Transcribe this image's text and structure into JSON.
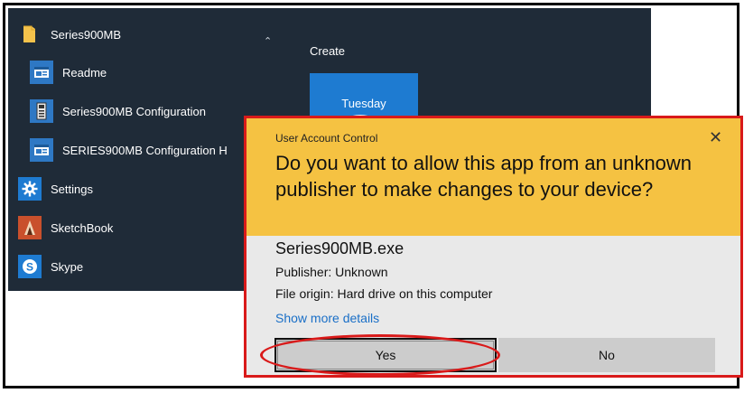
{
  "start_menu": {
    "group": {
      "label": "Series900MB",
      "icon": "folder-icon"
    },
    "items": [
      {
        "label": "Readme",
        "icon": "window-app-icon"
      },
      {
        "label": "Series900MB Configuration",
        "icon": "config-app-icon"
      },
      {
        "label": "SERIES900MB Configuration H",
        "icon": "window-app-icon"
      },
      {
        "label": "Settings",
        "icon": "gear-icon"
      },
      {
        "label": "SketchBook",
        "icon": "sketchbook-icon"
      },
      {
        "label": "Skype",
        "icon": "skype-icon"
      }
    ],
    "tiles_header": "Create",
    "calendar_tile": {
      "day": "Tuesday"
    }
  },
  "uac": {
    "title": "User Account Control",
    "close_glyph": "✕",
    "question": "Do you want to allow this app from an unknown publisher to make changes to your device?",
    "app_name": "Series900MB.exe",
    "publisher": "Publisher: Unknown",
    "file_origin": "File origin: Hard drive on this computer",
    "more_details": "Show more details",
    "yes_label": "Yes",
    "no_label": "No"
  },
  "colors": {
    "start_bg": "#1f2b38",
    "tile_blue": "#1e7bd1",
    "uac_header": "#f5c242",
    "highlight_red": "#d91a1a",
    "link_blue": "#1a6fc7"
  }
}
